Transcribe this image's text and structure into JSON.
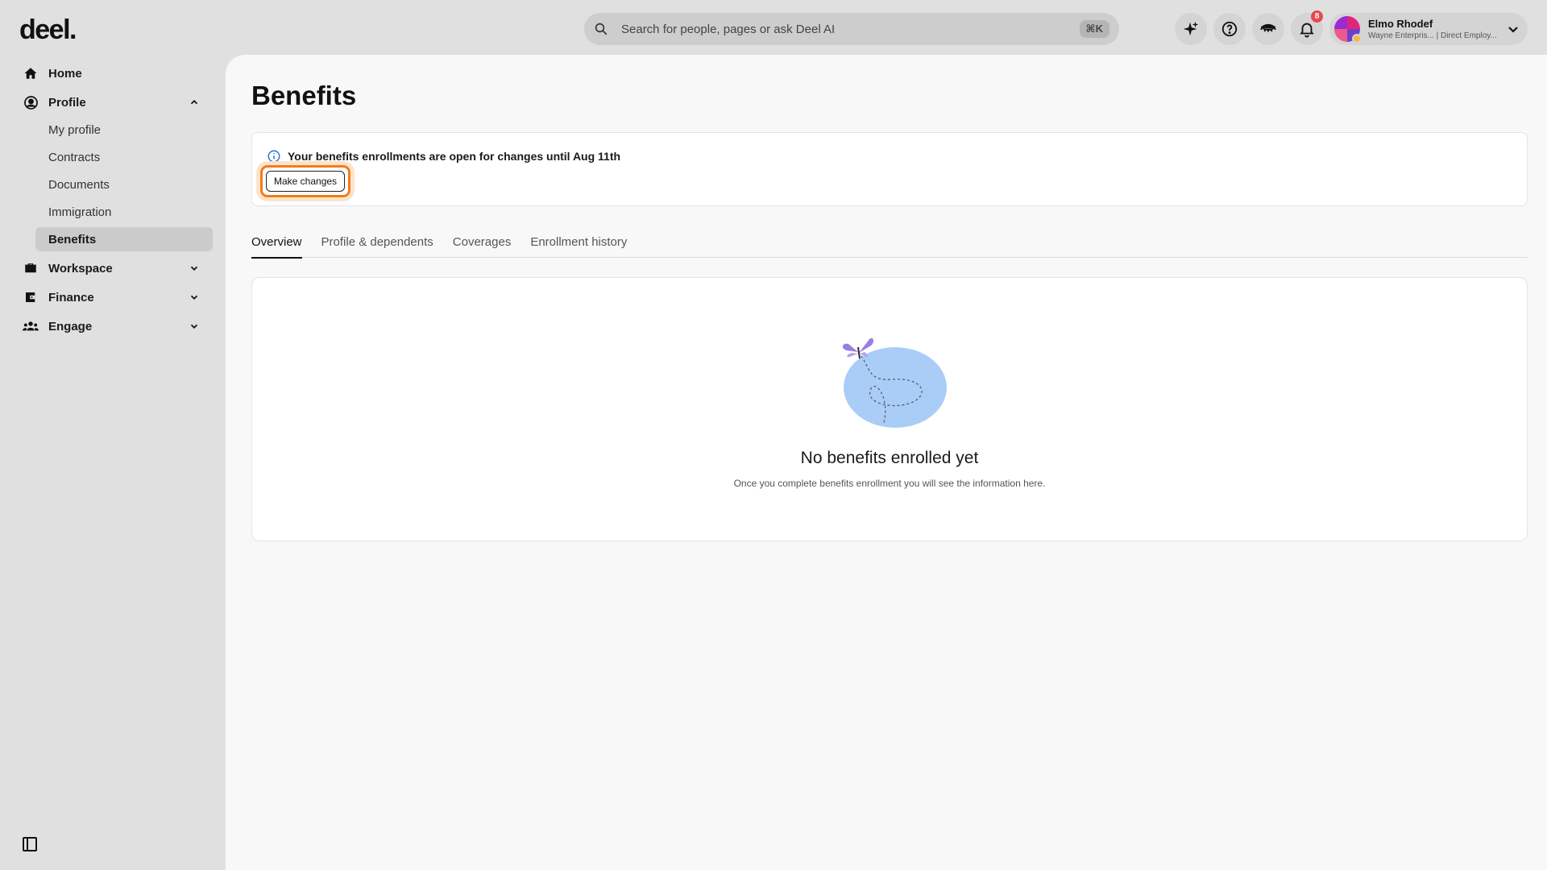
{
  "brand": {
    "logo": "deel."
  },
  "search": {
    "placeholder": "Search for people, pages or ask Deel AI",
    "shortcut": "⌘K"
  },
  "topbar": {
    "notification_count": "8",
    "user": {
      "name": "Elmo Rhodef",
      "subtitle": "Wayne Enterpris... | Direct Employ..."
    }
  },
  "sidebar": {
    "home": "Home",
    "profile": "Profile",
    "profile_items": [
      "My profile",
      "Contracts",
      "Documents",
      "Immigration",
      "Benefits"
    ],
    "workspace": "Workspace",
    "finance": "Finance",
    "engage": "Engage"
  },
  "page": {
    "title": "Benefits",
    "alert_text": "Your benefits enrollments are open for changes until Aug 11th",
    "alert_button": "Make changes",
    "tabs": [
      "Overview",
      "Profile & dependents",
      "Coverages",
      "Enrollment history"
    ],
    "active_tab": "Overview",
    "empty_title": "No benefits enrolled yet",
    "empty_subtitle": "Once you complete benefits enrollment you will see the information here."
  },
  "colors": {
    "highlight": "#f27c1b",
    "illustration_blob": "#a9cdf7",
    "butterfly": "#9a7ee6",
    "badge": "#e5484d"
  }
}
